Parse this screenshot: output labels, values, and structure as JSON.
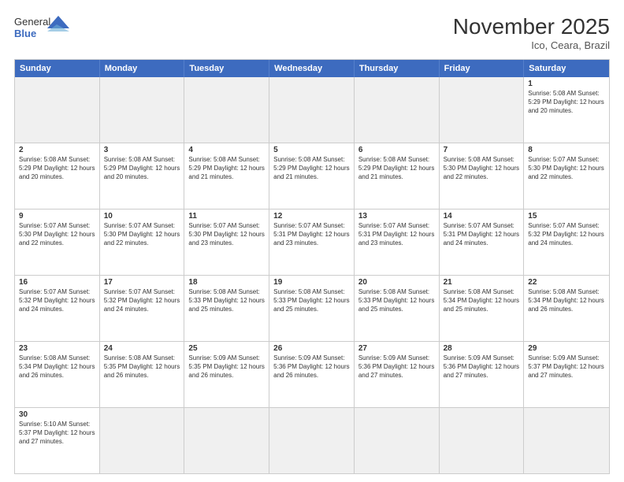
{
  "header": {
    "logo_general": "General",
    "logo_blue": "Blue",
    "month_title": "November 2025",
    "location": "Ico, Ceara, Brazil"
  },
  "calendar": {
    "days_of_week": [
      "Sunday",
      "Monday",
      "Tuesday",
      "Wednesday",
      "Thursday",
      "Friday",
      "Saturday"
    ],
    "rows": [
      [
        {
          "day": "",
          "info": "",
          "empty": true
        },
        {
          "day": "",
          "info": "",
          "empty": true
        },
        {
          "day": "",
          "info": "",
          "empty": true
        },
        {
          "day": "",
          "info": "",
          "empty": true
        },
        {
          "day": "",
          "info": "",
          "empty": true
        },
        {
          "day": "",
          "info": "",
          "empty": true
        },
        {
          "day": "1",
          "info": "Sunrise: 5:08 AM\nSunset: 5:29 PM\nDaylight: 12 hours and 20 minutes.",
          "empty": false
        }
      ],
      [
        {
          "day": "2",
          "info": "Sunrise: 5:08 AM\nSunset: 5:29 PM\nDaylight: 12 hours and 20 minutes.",
          "empty": false
        },
        {
          "day": "3",
          "info": "Sunrise: 5:08 AM\nSunset: 5:29 PM\nDaylight: 12 hours and 20 minutes.",
          "empty": false
        },
        {
          "day": "4",
          "info": "Sunrise: 5:08 AM\nSunset: 5:29 PM\nDaylight: 12 hours and 21 minutes.",
          "empty": false
        },
        {
          "day": "5",
          "info": "Sunrise: 5:08 AM\nSunset: 5:29 PM\nDaylight: 12 hours and 21 minutes.",
          "empty": false
        },
        {
          "day": "6",
          "info": "Sunrise: 5:08 AM\nSunset: 5:29 PM\nDaylight: 12 hours and 21 minutes.",
          "empty": false
        },
        {
          "day": "7",
          "info": "Sunrise: 5:08 AM\nSunset: 5:30 PM\nDaylight: 12 hours and 22 minutes.",
          "empty": false
        },
        {
          "day": "8",
          "info": "Sunrise: 5:07 AM\nSunset: 5:30 PM\nDaylight: 12 hours and 22 minutes.",
          "empty": false
        }
      ],
      [
        {
          "day": "9",
          "info": "Sunrise: 5:07 AM\nSunset: 5:30 PM\nDaylight: 12 hours and 22 minutes.",
          "empty": false
        },
        {
          "day": "10",
          "info": "Sunrise: 5:07 AM\nSunset: 5:30 PM\nDaylight: 12 hours and 22 minutes.",
          "empty": false
        },
        {
          "day": "11",
          "info": "Sunrise: 5:07 AM\nSunset: 5:30 PM\nDaylight: 12 hours and 23 minutes.",
          "empty": false
        },
        {
          "day": "12",
          "info": "Sunrise: 5:07 AM\nSunset: 5:31 PM\nDaylight: 12 hours and 23 minutes.",
          "empty": false
        },
        {
          "day": "13",
          "info": "Sunrise: 5:07 AM\nSunset: 5:31 PM\nDaylight: 12 hours and 23 minutes.",
          "empty": false
        },
        {
          "day": "14",
          "info": "Sunrise: 5:07 AM\nSunset: 5:31 PM\nDaylight: 12 hours and 24 minutes.",
          "empty": false
        },
        {
          "day": "15",
          "info": "Sunrise: 5:07 AM\nSunset: 5:32 PM\nDaylight: 12 hours and 24 minutes.",
          "empty": false
        }
      ],
      [
        {
          "day": "16",
          "info": "Sunrise: 5:07 AM\nSunset: 5:32 PM\nDaylight: 12 hours and 24 minutes.",
          "empty": false
        },
        {
          "day": "17",
          "info": "Sunrise: 5:07 AM\nSunset: 5:32 PM\nDaylight: 12 hours and 24 minutes.",
          "empty": false
        },
        {
          "day": "18",
          "info": "Sunrise: 5:08 AM\nSunset: 5:33 PM\nDaylight: 12 hours and 25 minutes.",
          "empty": false
        },
        {
          "day": "19",
          "info": "Sunrise: 5:08 AM\nSunset: 5:33 PM\nDaylight: 12 hours and 25 minutes.",
          "empty": false
        },
        {
          "day": "20",
          "info": "Sunrise: 5:08 AM\nSunset: 5:33 PM\nDaylight: 12 hours and 25 minutes.",
          "empty": false
        },
        {
          "day": "21",
          "info": "Sunrise: 5:08 AM\nSunset: 5:34 PM\nDaylight: 12 hours and 25 minutes.",
          "empty": false
        },
        {
          "day": "22",
          "info": "Sunrise: 5:08 AM\nSunset: 5:34 PM\nDaylight: 12 hours and 26 minutes.",
          "empty": false
        }
      ],
      [
        {
          "day": "23",
          "info": "Sunrise: 5:08 AM\nSunset: 5:34 PM\nDaylight: 12 hours and 26 minutes.",
          "empty": false
        },
        {
          "day": "24",
          "info": "Sunrise: 5:08 AM\nSunset: 5:35 PM\nDaylight: 12 hours and 26 minutes.",
          "empty": false
        },
        {
          "day": "25",
          "info": "Sunrise: 5:09 AM\nSunset: 5:35 PM\nDaylight: 12 hours and 26 minutes.",
          "empty": false
        },
        {
          "day": "26",
          "info": "Sunrise: 5:09 AM\nSunset: 5:36 PM\nDaylight: 12 hours and 26 minutes.",
          "empty": false
        },
        {
          "day": "27",
          "info": "Sunrise: 5:09 AM\nSunset: 5:36 PM\nDaylight: 12 hours and 27 minutes.",
          "empty": false
        },
        {
          "day": "28",
          "info": "Sunrise: 5:09 AM\nSunset: 5:36 PM\nDaylight: 12 hours and 27 minutes.",
          "empty": false
        },
        {
          "day": "29",
          "info": "Sunrise: 5:09 AM\nSunset: 5:37 PM\nDaylight: 12 hours and 27 minutes.",
          "empty": false
        }
      ],
      [
        {
          "day": "30",
          "info": "Sunrise: 5:10 AM\nSunset: 5:37 PM\nDaylight: 12 hours and 27 minutes.",
          "empty": false
        },
        {
          "day": "",
          "info": "",
          "empty": true
        },
        {
          "day": "",
          "info": "",
          "empty": true
        },
        {
          "day": "",
          "info": "",
          "empty": true
        },
        {
          "day": "",
          "info": "",
          "empty": true
        },
        {
          "day": "",
          "info": "",
          "empty": true
        },
        {
          "day": "",
          "info": "",
          "empty": true
        }
      ]
    ]
  }
}
